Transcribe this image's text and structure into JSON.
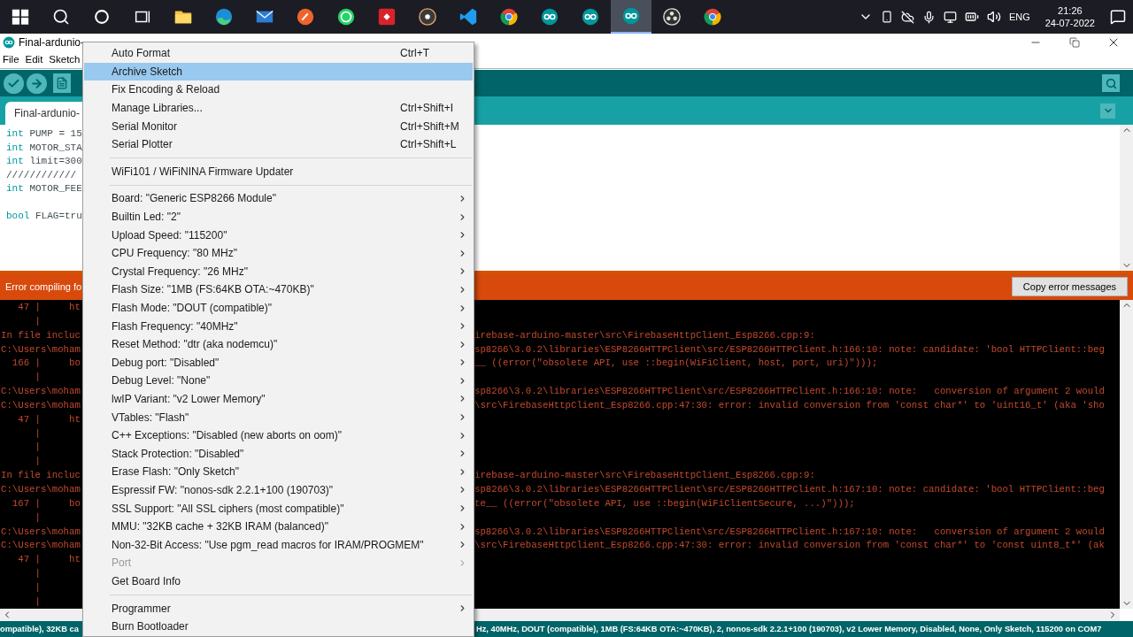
{
  "taskbar": {
    "apps": [
      {
        "kind": "windows",
        "selected": false
      },
      {
        "kind": "search",
        "selected": false
      },
      {
        "kind": "cortana",
        "selected": false
      },
      {
        "kind": "taskview",
        "selected": false
      },
      {
        "kind": "folder",
        "selected": false
      },
      {
        "kind": "edge",
        "selected": false
      },
      {
        "kind": "mail",
        "selected": false
      },
      {
        "kind": "pen",
        "selected": false
      },
      {
        "kind": "whatsapp",
        "selected": false
      },
      {
        "kind": "remote",
        "selected": false
      },
      {
        "kind": "disc",
        "selected": false
      },
      {
        "kind": "vscode",
        "selected": false
      },
      {
        "kind": "chrome",
        "selected": false
      },
      {
        "kind": "arduino",
        "selected": false
      },
      {
        "kind": "arduino",
        "selected": false
      },
      {
        "kind": "arduino",
        "selected": true
      },
      {
        "kind": "obs",
        "selected": false
      },
      {
        "kind": "chrome",
        "selected": false
      }
    ],
    "language": "ENG",
    "time": "21:26",
    "date": "24-07-2022"
  },
  "window": {
    "title": "Final-ardunio-",
    "menu": [
      "File",
      "Edit",
      "Sketch"
    ]
  },
  "tab": {
    "label": "Final-ardunio-"
  },
  "editor": {
    "lines": [
      {
        "keyword": "int",
        "text": " PUMP = 15"
      },
      {
        "keyword": "int",
        "text": " MOTOR_STA"
      },
      {
        "keyword": "int",
        "text": " limit=300"
      },
      {
        "text": "////////////"
      },
      {
        "keyword": "int",
        "text": " MOTOR_FEE"
      },
      {
        "keyword": "bool",
        "text": " FLAG=tru",
        "spaced": true
      }
    ]
  },
  "error_bar": {
    "message": "Error compiling fo",
    "button": "Copy error messages"
  },
  "console": {
    "lines": [
      {
        "left": "   47 |     ht"
      },
      {
        "left": "      |"
      },
      {
        "left": "In file incluc",
        "right": "irebase-arduino-master\\src\\FirebaseHttpClient_Esp8266.cpp:9:"
      },
      {
        "left": "C:\\Users\\moham",
        "right": "sp8266\\3.0.2\\libraries\\ESP8266HTTPClient\\src/ESP8266HTTPClient.h:166:10: note: candidate: 'bool HTTPClient::beg"
      },
      {
        "left": "  166 |     bo",
        "right": "__ ((error(\"obsolete API, use ::begin(WiFiClient, host, port, uri)\")));"
      },
      {
        "left": "      |"
      },
      {
        "left": "C:\\Users\\moham",
        "right": "sp8266\\3.0.2\\libraries\\ESP8266HTTPClient\\src/ESP8266HTTPClient.h:166:10: note:   conversion of argument 2 would"
      },
      {
        "left": "C:\\Users\\moham",
        "right": "\\src\\FirebaseHttpClient_Esp8266.cpp:47:30: error: invalid conversion from 'const char*' to 'uint16_t' (aka 'sho"
      },
      {
        "left": "   47 |     ht"
      },
      {
        "left": "      |"
      },
      {
        "left": "      |"
      },
      {
        "left": "      |"
      },
      {
        "left": "In file incluc",
        "right": "irebase-arduino-master\\src\\FirebaseHttpClient_Esp8266.cpp:9:"
      },
      {
        "left": "C:\\Users\\moham",
        "right": "sp8266\\3.0.2\\libraries\\ESP8266HTTPClient\\src/ESP8266HTTPClient.h:167:10: note: candidate: 'bool HTTPClient::beg"
      },
      {
        "left": "  167 |     bo",
        "right": "te__ ((error(\"obsolete API, use ::begin(WiFiClientSecure, ...)\")));"
      },
      {
        "left": "      |"
      },
      {
        "left": "C:\\Users\\moham",
        "right": "sp8266\\3.0.2\\libraries\\ESP8266HTTPClient\\src/ESP8266HTTPClient.h:167:10: note:   conversion of argument 2 would"
      },
      {
        "left": "C:\\Users\\moham",
        "right": "\\src\\FirebaseHttpClient_Esp8266.cpp:47:30: error: invalid conversion from 'const char*' to 'const uint8_t*' (ak"
      },
      {
        "left": "   47 |     ht"
      },
      {
        "left": "      |"
      },
      {
        "left": "      |"
      },
      {
        "left": "      |"
      }
    ]
  },
  "status_bar": {
    "left": "ompatible), 32KB ca",
    "right": "Hz, 40MHz, DOUT (compatible), 1MB (FS:64KB OTA:~470KB), 2, nonos-sdk 2.2.1+100 (190703), v2 Lower Memory, Disabled, None, Only Sketch, 115200 on COM7"
  },
  "menu": {
    "groups": [
      [
        {
          "label": "Auto Format",
          "shortcut": "Ctrl+T",
          "submenu": false,
          "disabled": false,
          "selected": false
        },
        {
          "label": "Archive Sketch",
          "submenu": false,
          "disabled": false,
          "selected": true
        },
        {
          "label": "Fix Encoding & Reload",
          "submenu": false,
          "disabled": false,
          "selected": false
        },
        {
          "label": "Manage Libraries...",
          "shortcut": "Ctrl+Shift+I",
          "submenu": false,
          "disabled": false,
          "selected": false
        },
        {
          "label": "Serial Monitor",
          "shortcut": "Ctrl+Shift+M",
          "submenu": false,
          "disabled": false,
          "selected": false
        },
        {
          "label": "Serial Plotter",
          "shortcut": "Ctrl+Shift+L",
          "submenu": false,
          "disabled": false,
          "selected": false
        }
      ],
      [
        {
          "label": "WiFi101 / WiFiNINA Firmware Updater",
          "submenu": false,
          "disabled": false,
          "selected": false
        }
      ],
      [
        {
          "label": "Board: \"Generic ESP8266 Module\"",
          "submenu": true,
          "disabled": false,
          "selected": false
        },
        {
          "label": "Builtin Led: \"2\"",
          "submenu": true,
          "disabled": false,
          "selected": false
        },
        {
          "label": "Upload Speed: \"115200\"",
          "submenu": true,
          "disabled": false,
          "selected": false
        },
        {
          "label": "CPU Frequency: \"80 MHz\"",
          "submenu": true,
          "disabled": false,
          "selected": false
        },
        {
          "label": "Crystal Frequency: \"26 MHz\"",
          "submenu": true,
          "disabled": false,
          "selected": false
        },
        {
          "label": "Flash Size: \"1MB (FS:64KB OTA:~470KB)\"",
          "submenu": true,
          "disabled": false,
          "selected": false
        },
        {
          "label": "Flash Mode: \"DOUT (compatible)\"",
          "submenu": true,
          "disabled": false,
          "selected": false
        },
        {
          "label": "Flash Frequency: \"40MHz\"",
          "submenu": true,
          "disabled": false,
          "selected": false
        },
        {
          "label": "Reset Method: \"dtr (aka nodemcu)\"",
          "submenu": true,
          "disabled": false,
          "selected": false
        },
        {
          "label": "Debug port: \"Disabled\"",
          "submenu": true,
          "disabled": false,
          "selected": false
        },
        {
          "label": "Debug Level: \"None\"",
          "submenu": true,
          "disabled": false,
          "selected": false
        },
        {
          "label": "lwIP Variant: \"v2 Lower Memory\"",
          "submenu": true,
          "disabled": false,
          "selected": false
        },
        {
          "label": "VTables: \"Flash\"",
          "submenu": true,
          "disabled": false,
          "selected": false
        },
        {
          "label": "C++ Exceptions: \"Disabled (new aborts on oom)\"",
          "submenu": true,
          "disabled": false,
          "selected": false
        },
        {
          "label": "Stack Protection: \"Disabled\"",
          "submenu": true,
          "disabled": false,
          "selected": false
        },
        {
          "label": "Erase Flash: \"Only Sketch\"",
          "submenu": true,
          "disabled": false,
          "selected": false
        },
        {
          "label": "Espressif FW: \"nonos-sdk 2.2.1+100 (190703)\"",
          "submenu": true,
          "disabled": false,
          "selected": false
        },
        {
          "label": "SSL Support: \"All SSL ciphers (most compatible)\"",
          "submenu": true,
          "disabled": false,
          "selected": false
        },
        {
          "label": "MMU: \"32KB cache + 32KB IRAM (balanced)\"",
          "submenu": true,
          "disabled": false,
          "selected": false
        },
        {
          "label": "Non-32-Bit Access: \"Use pgm_read macros for IRAM/PROGMEM\"",
          "submenu": true,
          "disabled": false,
          "selected": false
        },
        {
          "label": "Port",
          "submenu": true,
          "disabled": true,
          "selected": false
        },
        {
          "label": "Get Board Info",
          "submenu": false,
          "disabled": false,
          "selected": false
        }
      ],
      [
        {
          "label": "Programmer",
          "submenu": true,
          "disabled": false,
          "selected": false
        },
        {
          "label": "Burn Bootloader",
          "submenu": false,
          "disabled": false,
          "selected": false
        }
      ]
    ]
  }
}
